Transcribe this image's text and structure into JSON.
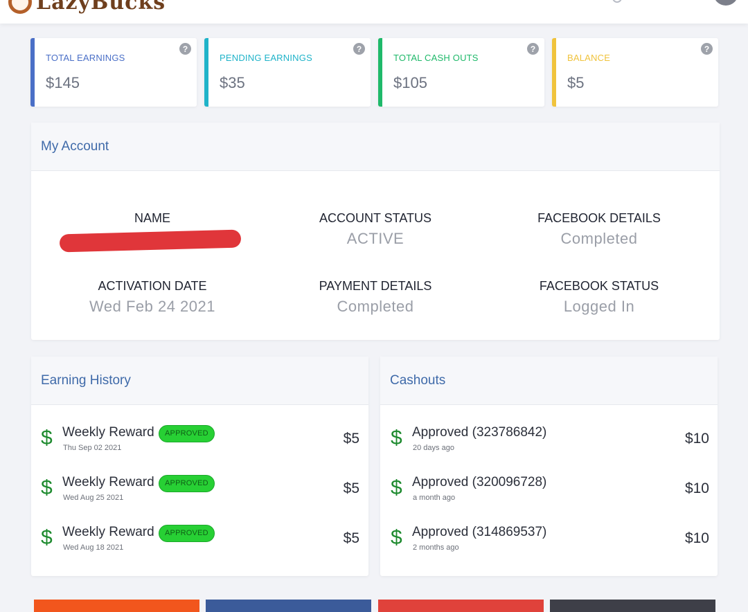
{
  "header": {
    "brand": "LazyBucks"
  },
  "stats": [
    {
      "label": "TOTAL EARNINGS",
      "value": "$145",
      "color": "#4a6fc7"
    },
    {
      "label": "PENDING EARNINGS",
      "value": "$35",
      "color": "#1fb3c9"
    },
    {
      "label": "TOTAL CASH OUTS",
      "value": "$105",
      "color": "#1fb96a"
    },
    {
      "label": "BALANCE",
      "value": "$5",
      "color": "#f0c33c"
    }
  ],
  "account": {
    "title": "My Account",
    "fields": [
      {
        "label": "NAME",
        "value": ""
      },
      {
        "label": "ACCOUNT STATUS",
        "value": "ACTIVE"
      },
      {
        "label": "FACEBOOK DETAILS",
        "value": "Completed"
      },
      {
        "label": "ACTIVATION DATE",
        "value": "Wed Feb 24 2021"
      },
      {
        "label": "PAYMENT DETAILS",
        "value": "Completed"
      },
      {
        "label": "FACEBOOK STATUS",
        "value": "Logged In"
      }
    ]
  },
  "earning_history": {
    "title": "Earning History",
    "items": [
      {
        "title": "Weekly Reward",
        "date": "Thu Sep 02 2021",
        "status": "APPROVED",
        "amount": "$5"
      },
      {
        "title": "Weekly Reward",
        "date": "Wed Aug 25 2021",
        "status": "APPROVED",
        "amount": "$5"
      },
      {
        "title": "Weekly Reward",
        "date": "Wed Aug 18 2021",
        "status": "APPROVED",
        "amount": "$5"
      }
    ]
  },
  "cashouts": {
    "title": "Cashouts",
    "items": [
      {
        "title": "Approved (323786842)",
        "date": "20 days ago",
        "amount": "$10"
      },
      {
        "title": "Approved (320096728)",
        "date": "a month ago",
        "amount": "$10"
      },
      {
        "title": "Approved (314869537)",
        "date": "2 months ago",
        "amount": "$10"
      }
    ]
  },
  "icons": {
    "currency": "$",
    "help": "?"
  },
  "bottom_buttons": [
    {
      "color": "#f2561d"
    },
    {
      "color": "#3b5b9a"
    },
    {
      "color": "#e0423b"
    },
    {
      "color": "#3e3f48"
    }
  ]
}
